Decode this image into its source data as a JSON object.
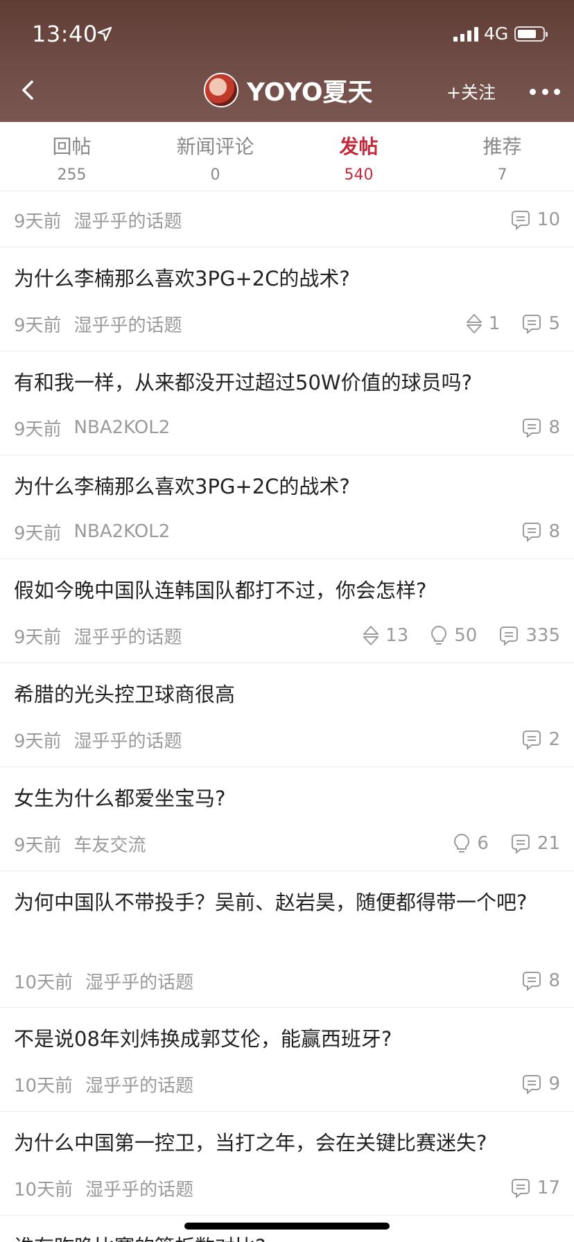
{
  "status_bar": {
    "time": "13:40",
    "network": "4G",
    "battery_level": 0.6
  },
  "header": {
    "username": "YOYO夏天",
    "follow_label": "+关注"
  },
  "tabs": [
    {
      "label": "回帖",
      "count": "255"
    },
    {
      "label": "新闻评论",
      "count": "0"
    },
    {
      "label": "发帖",
      "count": "540"
    },
    {
      "label": "推荐",
      "count": "7"
    }
  ],
  "active_tab": "发帖",
  "colors": {
    "accent": "#c4283b",
    "header_bg": "#6a463f",
    "meta_gray": "#9a9a9a"
  },
  "posts": [
    {
      "title": "",
      "time": "9天前",
      "board": "湿乎乎的话题",
      "comments": "10"
    },
    {
      "title": "为什么李楠那么喜欢3PG+2C的战术?",
      "time": "9天前",
      "board": "湿乎乎的话题",
      "upvotes": "1",
      "comments": "5"
    },
    {
      "title": "有和我一样，从来都没开过超过50W价值的球员吗?",
      "time": "9天前",
      "board": "NBA2KOL2",
      "comments": "8"
    },
    {
      "title": "为什么李楠那么喜欢3PG+2C的战术?",
      "time": "9天前",
      "board": "NBA2KOL2",
      "comments": "8"
    },
    {
      "title": "假如今晚中国队连韩国队都打不过，你会怎样?",
      "time": "9天前",
      "board": "湿乎乎的话题",
      "upvotes": "13",
      "lights": "50",
      "comments": "335"
    },
    {
      "title": "希腊的光头控卫球商很高",
      "time": "9天前",
      "board": "湿乎乎的话题",
      "comments": "2"
    },
    {
      "title": "女生为什么都爱坐宝马?",
      "time": "9天前",
      "board": "车友交流",
      "lights": "6",
      "comments": "21"
    },
    {
      "title": "为何中国队不带投手？吴前、赵岩昊，随便都得带一个吧?",
      "time": "10天前",
      "board": "湿乎乎的话题",
      "comments": "8"
    },
    {
      "title": "不是说08年刘炜换成郭艾伦，能赢西班牙?",
      "time": "10天前",
      "board": "湿乎乎的话题",
      "comments": "9"
    },
    {
      "title": "为什么中国第一控卫，当打之年，会在关键比赛迷失?",
      "time": "10天前",
      "board": "湿乎乎的话题",
      "comments": "17"
    },
    {
      "title": "谁有昨晚比赛的篮板数对比?"
    }
  ]
}
